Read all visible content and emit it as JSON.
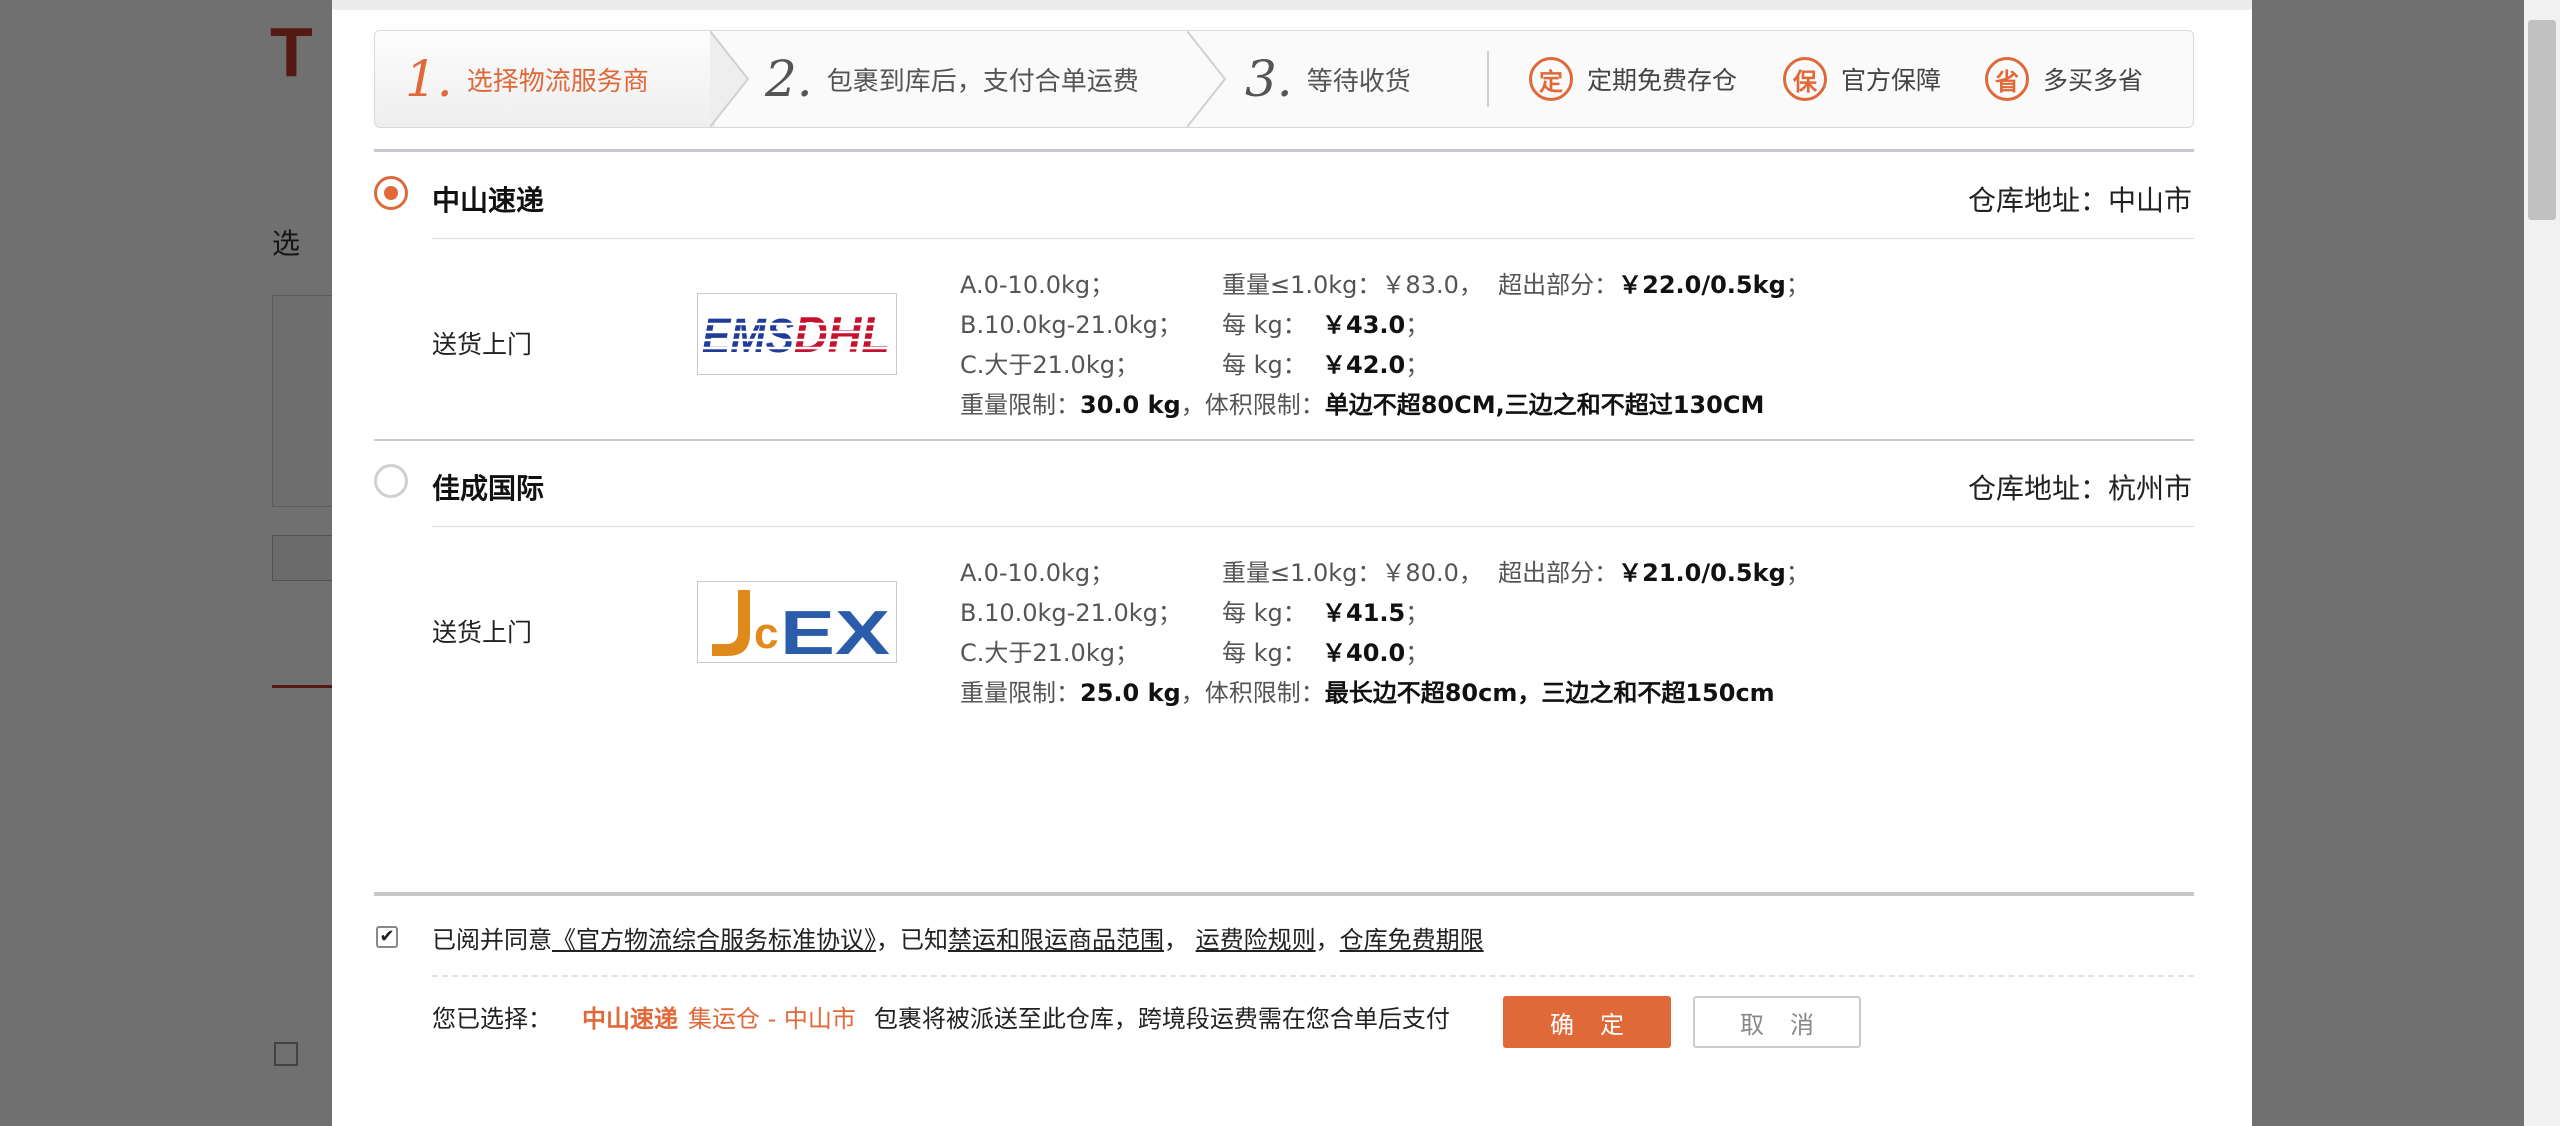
{
  "steps": [
    {
      "num": "1.",
      "label": "选择物流服务商",
      "active": true
    },
    {
      "num": "2.",
      "label": "包裹到库后，支付合单运费",
      "active": false
    },
    {
      "num": "3.",
      "label": "等待收货",
      "active": false
    }
  ],
  "features": [
    {
      "icon": "ding-badge-icon",
      "glyph": "定",
      "label": "定期免费存仓"
    },
    {
      "icon": "bao-badge-icon",
      "glyph": "保",
      "label": "官方保障"
    },
    {
      "icon": "sheng-badge-icon",
      "glyph": "省",
      "label": "多买多省"
    }
  ],
  "carriers": [
    {
      "name": "中山速递",
      "selected": true,
      "warehouse": "仓库地址：中山市",
      "delivery": "送货上门",
      "logo": "EMS DHL",
      "rates": [
        {
          "range": "A.0-10.0kg；",
          "label": "重量≤1.0kg：",
          "price": "￥83.0，",
          "extra_label": "超出部分：",
          "extra": "￥22.0/0.5kg",
          "end": "；"
        },
        {
          "range": "B.10.0kg-21.0kg；",
          "label": "每 kg：",
          "price": "￥43.0",
          "end": "；"
        },
        {
          "range": "C.大于21.0kg；",
          "label": "每 kg：",
          "price": "￥42.0",
          "end": "；"
        }
      ],
      "weight_label": "重量限制：",
      "weight_value": "30.0 kg",
      "volume_label": "，体积限制：",
      "volume_value": "单边不超80CM,三边之和不超过130CM"
    },
    {
      "name": "佳成国际",
      "selected": false,
      "warehouse": "仓库地址：杭州市",
      "delivery": "送货上门",
      "logo": "JCEX",
      "rates": [
        {
          "range": "A.0-10.0kg；",
          "label": "重量≤1.0kg：",
          "price": "￥80.0，",
          "extra_label": "超出部分：",
          "extra": "￥21.0/0.5kg",
          "end": "；"
        },
        {
          "range": "B.10.0kg-21.0kg；",
          "label": "每 kg：",
          "price": "￥41.5",
          "end": "；"
        },
        {
          "range": "C.大于21.0kg；",
          "label": "每 kg：",
          "price": "￥40.0",
          "end": "；"
        }
      ],
      "weight_label": "重量限制：",
      "weight_value": "25.0 kg",
      "volume_label": "，体积限制：",
      "volume_value": "最长边不超80cm，三边之和不超150cm"
    }
  ],
  "agreement": {
    "checked": true,
    "prefix": "已阅并同意",
    "link1": "《官方物流综合服务标准协议》",
    "mid": "，已知",
    "link2": "禁运和限运商品范围",
    "sep1": "，",
    "link3": "运费险规则",
    "sep2": "，",
    "link4": "仓库免费期限"
  },
  "selection": {
    "label": "您已选择：",
    "carrier": "中山速递",
    "warehouse": "集运仓 - 中山市",
    "note": "包裹将被派送至此仓库，跨境段运费需在您合单后支付"
  },
  "buttons": {
    "confirm": "确定",
    "cancel": "取消"
  },
  "background": {
    "letter": "T",
    "text": "选"
  },
  "colors": {
    "accent": "#e0693a",
    "ems_blue": "#1f3c99",
    "dhl_red": "#c8102e",
    "jcex_orange": "#e08a1c",
    "jcex_blue": "#2a5caa"
  }
}
